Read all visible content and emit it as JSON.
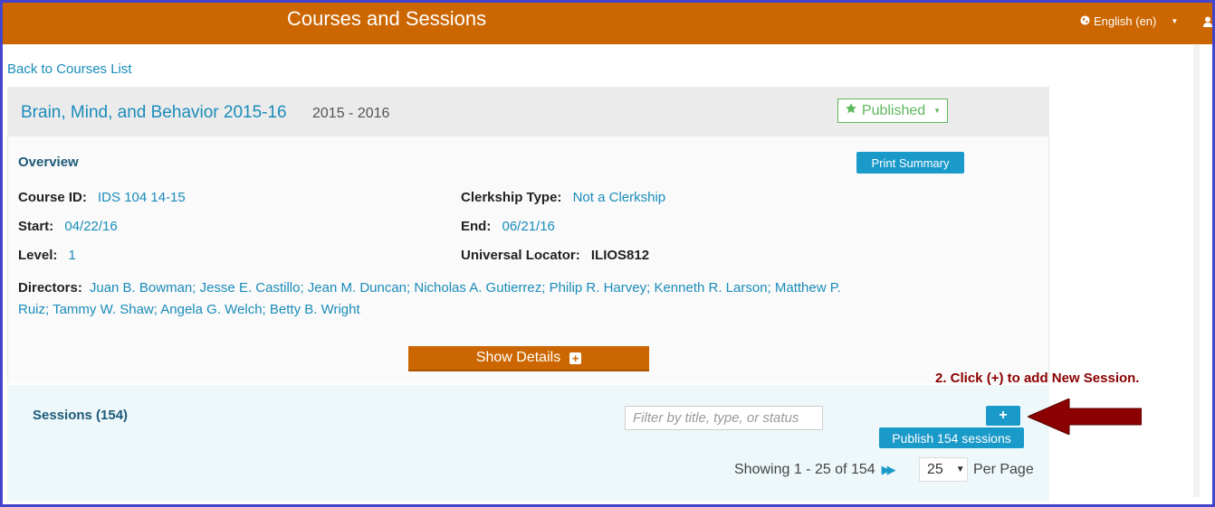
{
  "header": {
    "title": "Courses and Sessions",
    "language": "English (en)"
  },
  "nav": {
    "back_link": "Back to Courses List"
  },
  "course": {
    "title": "Brain, Mind, and Behavior 2015-16",
    "years": "2015 - 2016",
    "status": "Published"
  },
  "overview": {
    "title": "Overview",
    "print_label": "Print Summary",
    "course_id_label": "Course ID:",
    "course_id": "IDS 104 14-15",
    "clerkship_label": "Clerkship Type:",
    "clerkship": "Not a Clerkship",
    "start_label": "Start:",
    "start": "04/22/16",
    "end_label": "End:",
    "end": "06/21/16",
    "level_label": "Level:",
    "level": "1",
    "locator_label": "Universal Locator:",
    "locator": "ILIOS812",
    "directors_label": "Directors:",
    "directors": "Juan B. Bowman; Jesse E. Castillo; Jean M. Duncan; Nicholas A. Gutierrez; Philip R. Harvey; Kenneth R. Larson; Matthew P. Ruiz; Tammy W. Shaw; Angela G. Welch; Betty B. Wright",
    "show_details": "Show Details"
  },
  "sessions": {
    "title": "Sessions (154)",
    "filter_placeholder": "Filter by title, type, or status",
    "add_label": "+",
    "publish_label": "Publish 154 sessions",
    "showing": "Showing 1 - 25 of 154",
    "per_page_value": "25",
    "per_page_label": "Per Page"
  },
  "annotation": {
    "text": "2. Click (+) to add New Session."
  },
  "colors": {
    "header_bg": "#cc6600",
    "link": "#1a8cba",
    "button_blue": "#1a9ac9",
    "published_green": "#5cb85c",
    "annotation_red": "#8b0000",
    "frame_border": "#4444cc"
  }
}
